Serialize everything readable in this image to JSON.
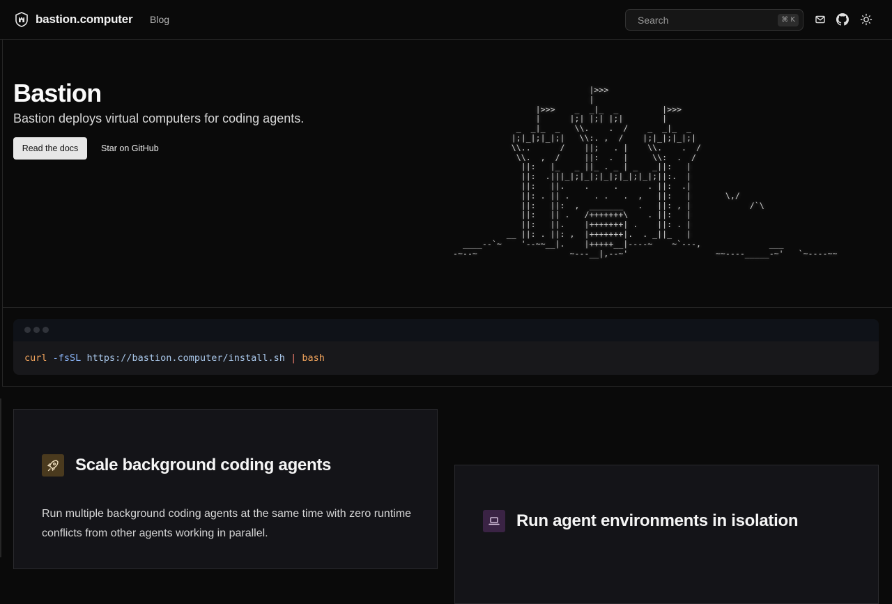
{
  "header": {
    "brand": "bastion.computer",
    "nav_blog": "Blog",
    "search_placeholder": "Search",
    "search_shortcut": "⌘ K"
  },
  "hero": {
    "title": "Bastion",
    "subtitle": "Bastion deploys virtual computers for coding agents.",
    "primary_button": "Read the docs",
    "secondary_link": "Star on GitHub",
    "ascii_art": "                            |>>>\n                            |\n                 |>>>    _  _|_  _         |>>>\n                 |      |;| |;| |;|        |\n             _  _|_  _   \\\\.    .  /    _  _|_  _\n            |;|_|;|_|;|   \\\\:. ,  /    |;|_|;|_|;|\n            \\\\..      /    ||;   . |    \\\\.    .  /\n             \\\\.  ,  /     ||:  .  |     \\\\:  .  /\n              ||:   |_   _ ||_ . _ | _   _||:   |\n              ||:  .|||_|;|_|;|_|;|_|;|_|;||:.  |\n              ||:   ||.    .     .      . ||:  .|\n              ||: . || .     . .   .  ,   ||:   |       \\,/\n              ||:   ||:  ,  _______   .   ||: , |            /`\\\n              ||:   || .   /+++++++\\    . ||:   |\n              ||:   ||.    |+++++++| .    ||: . |\n           __ ||: . ||: ,  |+++++++|.  . _||_   |\n  ____--`~    '--~~__|.    |+++++__|----~    ~`---,              ___\n-~--~                   ~---__|,--~'                  ~~----_____-~'   `~----~~"
  },
  "install": {
    "cmd": "curl",
    "flag": "-fsSL",
    "url": "https://bastion.computer/install.sh",
    "pipe": "|",
    "shell": "bash"
  },
  "features": [
    {
      "title": "Scale background coding agents",
      "description": "Run multiple background coding agents at the same time with zero runtime conflicts from other agents working in parallel.",
      "icon": "rocket-icon",
      "color": "#4a3a1e"
    },
    {
      "title": "Run agent environments in isolation",
      "icon": "laptop-icon",
      "color": "#3a2344"
    }
  ]
}
